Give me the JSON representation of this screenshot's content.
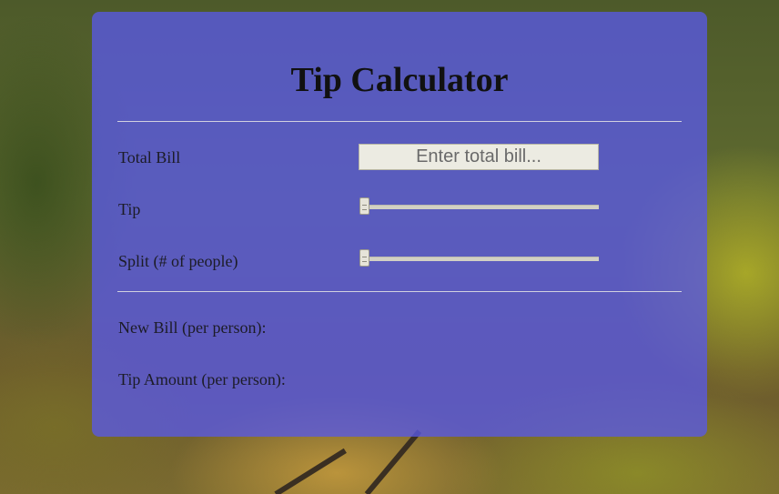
{
  "app": {
    "title": "Tip Calculator"
  },
  "form": {
    "total_bill_label": "Total Bill",
    "total_bill_placeholder": "Enter total bill...",
    "total_bill_value": "",
    "tip_label": "Tip",
    "tip_slider_value": 0,
    "split_label": "Split (# of people)",
    "split_slider_value": 0
  },
  "results": {
    "new_bill_label": "New Bill (per person):",
    "tip_amount_label": "Tip Amount (per person):"
  },
  "colors": {
    "card_background": "#5858e6",
    "input_background": "#ecebe2"
  }
}
